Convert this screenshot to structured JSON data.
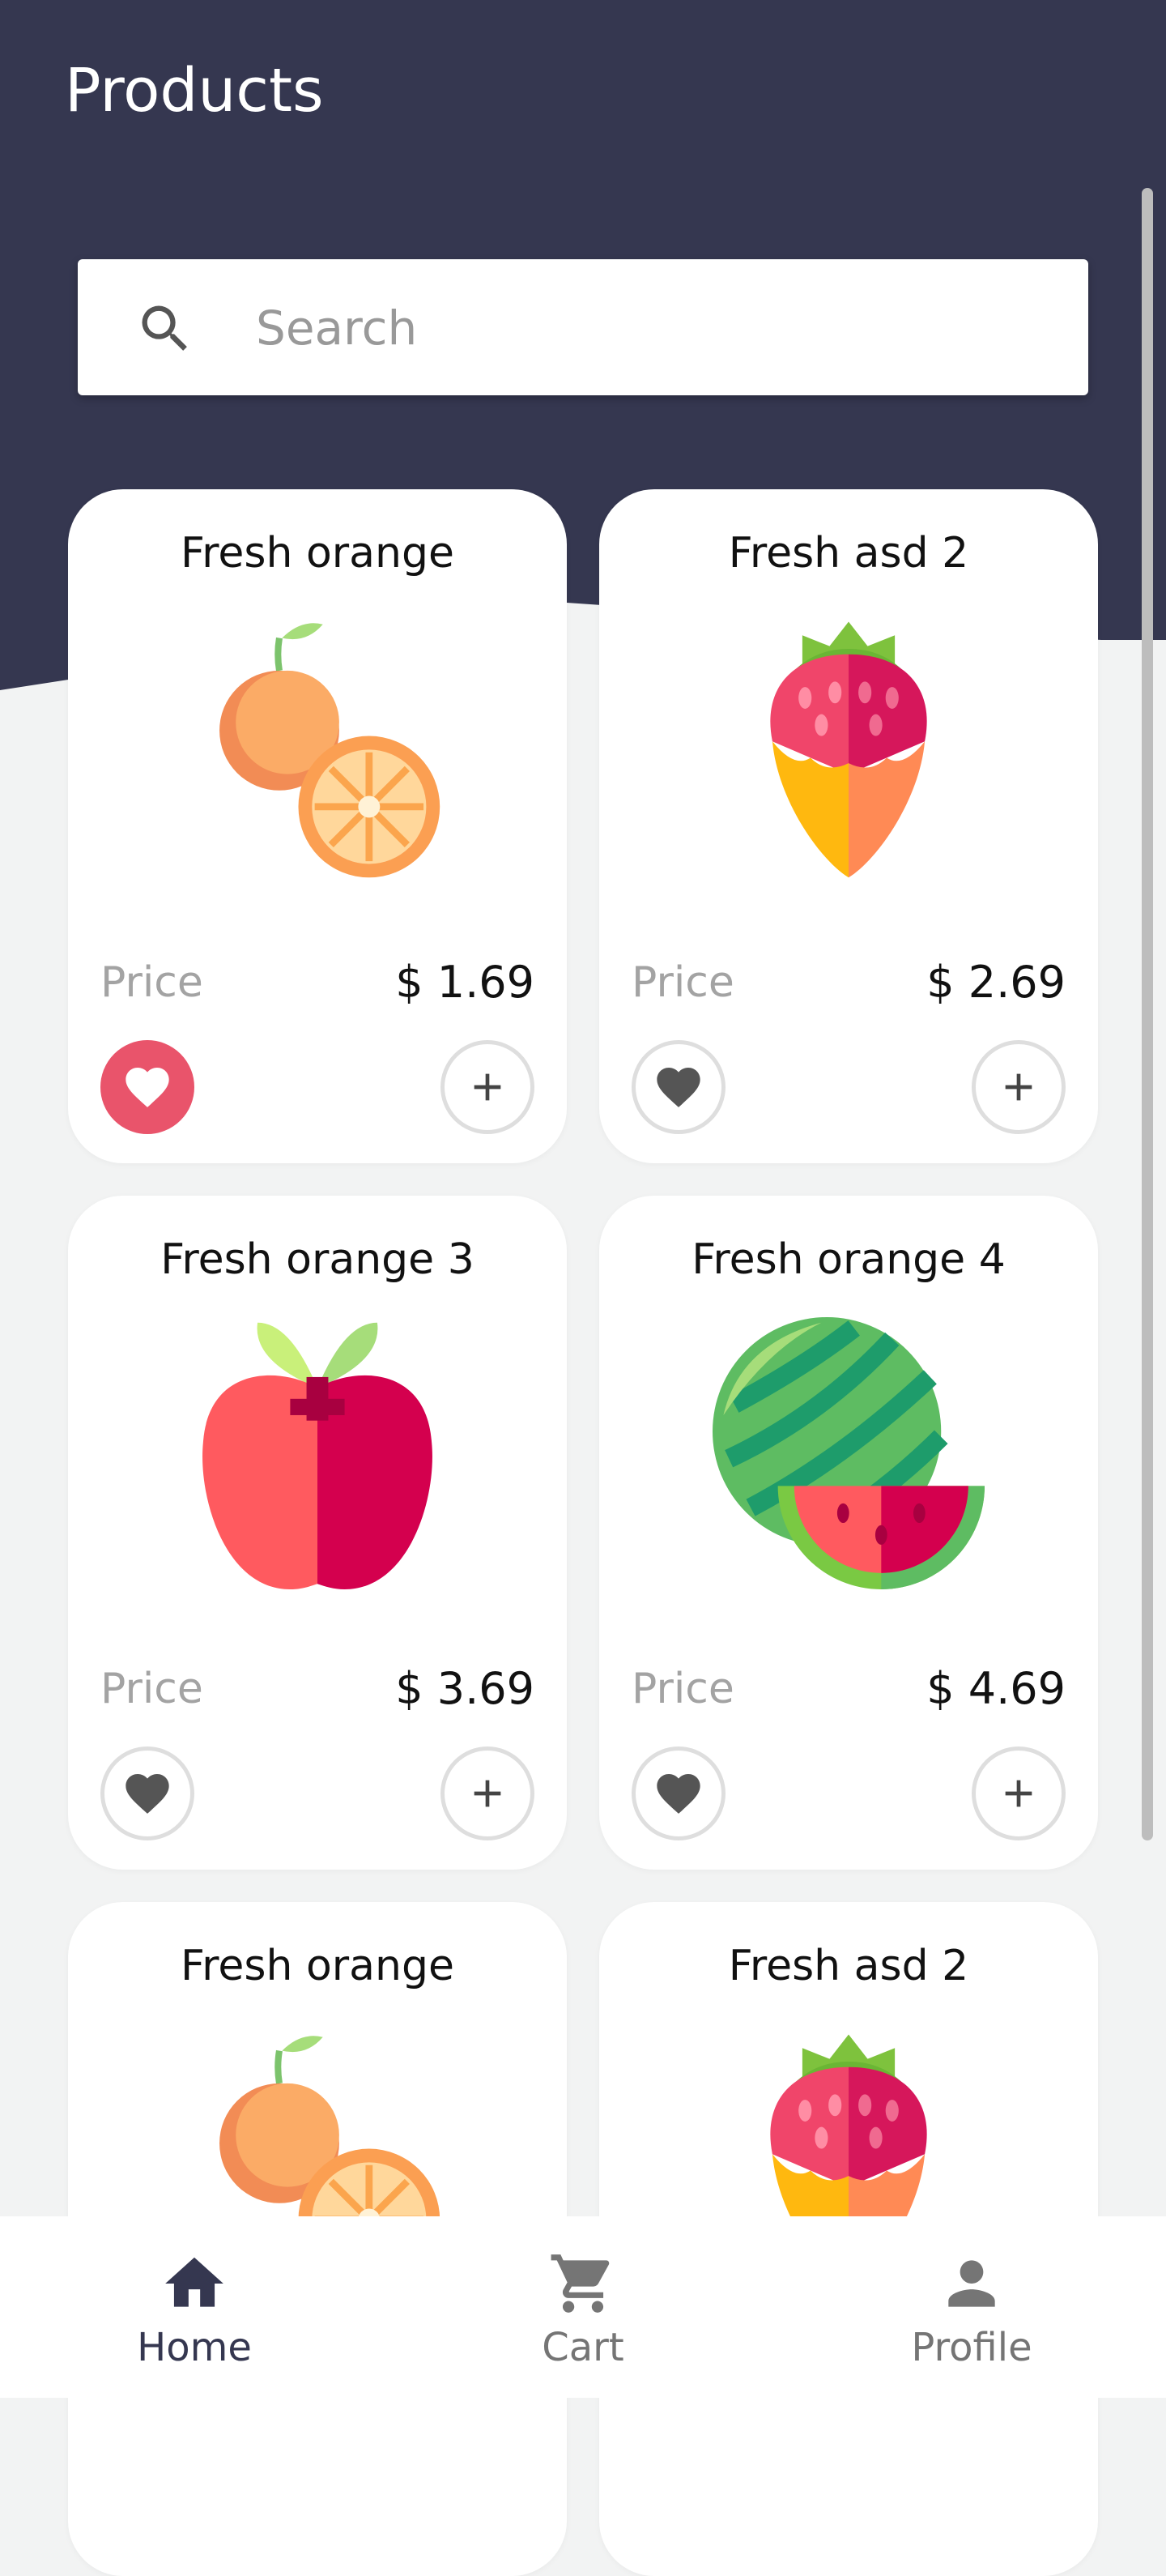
{
  "header": {
    "title": "Products"
  },
  "search": {
    "placeholder": "Search",
    "value": ""
  },
  "card_labels": {
    "price_label": "Price"
  },
  "products": [
    {
      "name": "Fresh orange",
      "price": "$ 1.69",
      "image": "orange-icon",
      "favorite": true
    },
    {
      "name": "Fresh asd 2",
      "price": "$ 2.69",
      "image": "strawberry-icon",
      "favorite": false
    },
    {
      "name": "Fresh orange 3",
      "price": "$ 3.69",
      "image": "apple-icon",
      "favorite": false
    },
    {
      "name": "Fresh orange 4",
      "price": "$ 4.69",
      "image": "watermelon-icon",
      "favorite": false
    },
    {
      "name": "Fresh orange",
      "image": "orange-icon"
    },
    {
      "name": "Fresh asd 2",
      "image": "strawberry-icon"
    }
  ],
  "bottom_nav": {
    "active": "Home",
    "items": [
      {
        "label": "Home",
        "icon": "home-icon"
      },
      {
        "label": "Cart",
        "icon": "cart-icon"
      },
      {
        "label": "Profile",
        "icon": "person-icon"
      }
    ]
  },
  "colors": {
    "header_bg": "#353750",
    "page_bg": "#f2f3f3",
    "favorite_active": "#e9546b",
    "nav_active": "#353750",
    "nav_inactive": "#757575"
  }
}
